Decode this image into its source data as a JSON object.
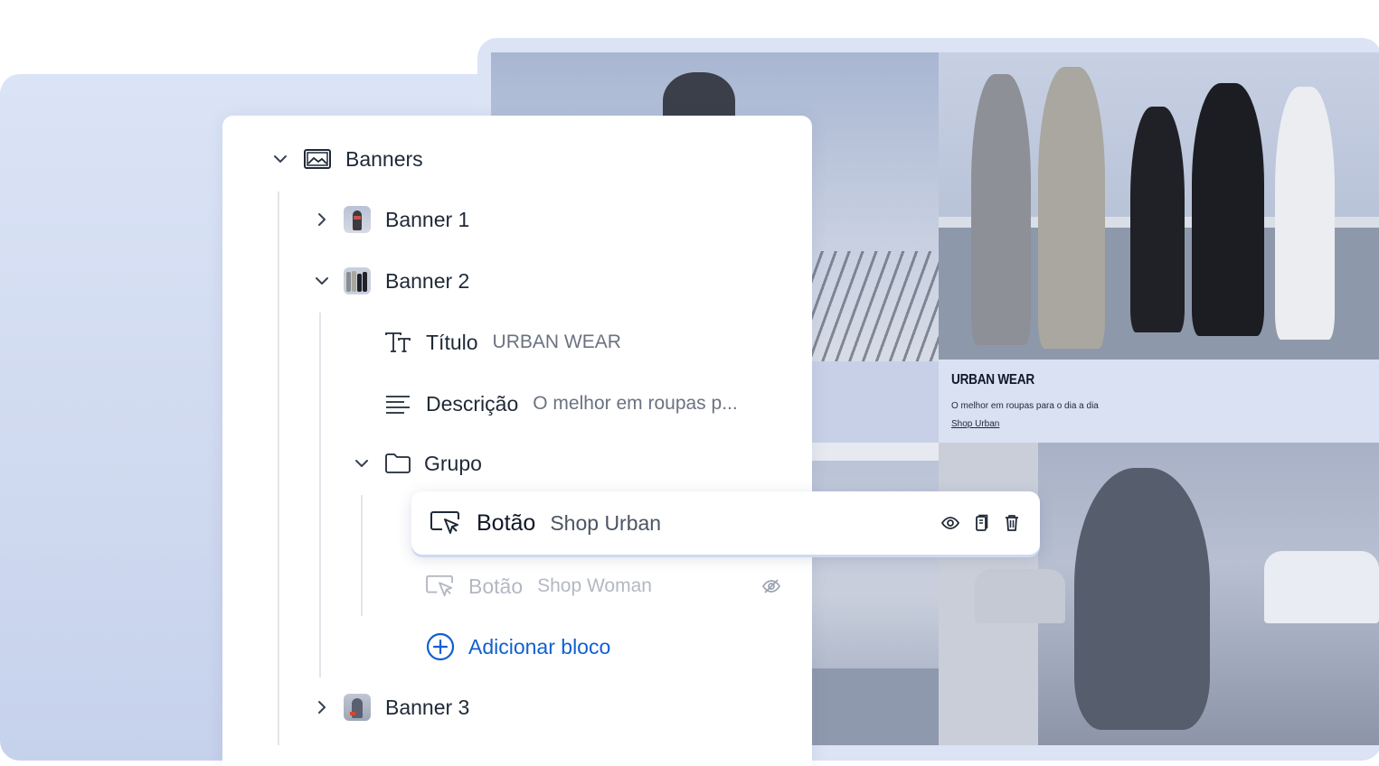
{
  "tree": {
    "root": {
      "label": "Banners",
      "icon": "image-icon",
      "expanded": true
    },
    "banner1": {
      "label": "Banner 1",
      "expanded": false
    },
    "banner2": {
      "label": "Banner 2",
      "expanded": true
    },
    "titulo": {
      "label": "Título",
      "value": "URBAN WEAR",
      "icon": "text-type-icon"
    },
    "descricao": {
      "label": "Descrição",
      "value": "O melhor em roupas p...",
      "icon": "paragraph-icon"
    },
    "grupo": {
      "label": "Grupo",
      "icon": "folder-icon",
      "expanded": true
    },
    "botao1": {
      "label": "Botão",
      "value": "Shop Urban",
      "icon": "cursor-click-icon",
      "selected": true,
      "actions": [
        "eye-icon",
        "copy-icon",
        "trash-icon"
      ]
    },
    "botao2": {
      "label": "Botão",
      "value": "Shop Woman",
      "icon": "cursor-click-icon",
      "hidden": true,
      "actions": [
        "eye-off-icon"
      ]
    },
    "add": {
      "label": "Adicionar bloco",
      "icon": "plus-circle-icon"
    },
    "banner3": {
      "label": "Banner 3",
      "expanded": false
    }
  },
  "preview": {
    "title": "URBAN WEAR",
    "description": "O melhor em roupas para o dia a dia",
    "link": "Shop Urban"
  },
  "colors": {
    "accent": "#1060d0",
    "panel_bg": "#ffffff",
    "backdrop": "#dbe3f5"
  }
}
